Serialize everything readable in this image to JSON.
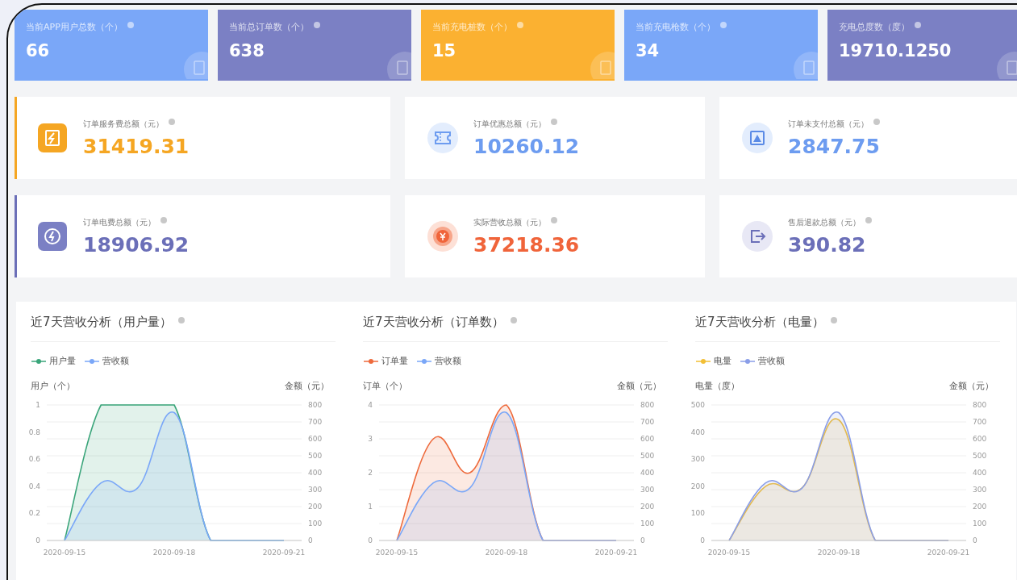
{
  "stat_cards": [
    {
      "label": "当前APP用户总数（个）",
      "value": "66",
      "color": "#7aa7f8"
    },
    {
      "label": "当前总订单数（个）",
      "value": "638",
      "color": "#7b80c4"
    },
    {
      "label": "当前充电桩数（个）",
      "value": "15",
      "color": "#fbb131"
    },
    {
      "label": "当前充电枪数（个）",
      "value": "34",
      "color": "#7aa7f8"
    },
    {
      "label": "充电总度数（度）",
      "value": "19710.1250",
      "color": "#7b80c4"
    }
  ],
  "amount_cards": [
    {
      "label": "订单服务费总额（元）",
      "value": "31419.31",
      "color": "#f5a623",
      "accent_bar": true
    },
    {
      "label": "订单优惠总额（元）",
      "value": "10260.12",
      "color": "#6d9cf0",
      "accent_bar": false
    },
    {
      "label": "订单未支付总额（元）",
      "value": "2847.75",
      "color": "#6d9cf0",
      "accent_bar": false
    },
    {
      "label": "订单电费总额（元）",
      "value": "18906.92",
      "color": "#6b6fb8",
      "accent_bar": true
    },
    {
      "label": "实际营收总额（元）",
      "value": "37218.36",
      "color": "#f0643a",
      "accent_bar": false
    },
    {
      "label": "售后退款总额（元）",
      "value": "390.82",
      "color": "#6b6fb8",
      "accent_bar": false
    }
  ],
  "charts": [
    {
      "title": "近7天营收分析（用户量）",
      "chart_data": {
        "type": "area",
        "ylabel": "用户（个）",
        "y2label": "金额（元）",
        "categories": [
          "2020-09-15",
          null,
          null,
          "2020-09-18",
          null,
          null,
          "2020-09-21"
        ],
        "grid": true,
        "ylim": [
          0,
          1
        ],
        "yticks": [
          0,
          0.2,
          0.4,
          0.6,
          0.8,
          1
        ],
        "y2lim": [
          0,
          800
        ],
        "y2ticks": [
          0,
          100,
          200,
          300,
          400,
          500,
          600,
          700,
          800
        ],
        "series": [
          {
            "name": "用户量",
            "color": "#3aa57a",
            "values": [
              0,
              1,
              1,
              1,
              0,
              0,
              0
            ]
          },
          {
            "name": "营收额",
            "color": "#7aa7f8",
            "axis": "y2",
            "values": [
              0,
              340,
              310,
              755,
              0,
              0,
              0
            ]
          }
        ]
      }
    },
    {
      "title": "近7天营收分析（订单数）",
      "chart_data": {
        "type": "area",
        "ylabel": "订单（个）",
        "y2label": "金额（元）",
        "categories": [
          "2020-09-15",
          null,
          null,
          "2020-09-18",
          null,
          null,
          "2020-09-21"
        ],
        "grid": true,
        "ylim": [
          0,
          4
        ],
        "yticks": [
          0,
          1,
          2,
          3,
          4
        ],
        "y2lim": [
          0,
          800
        ],
        "y2ticks": [
          0,
          100,
          200,
          300,
          400,
          500,
          600,
          700,
          800
        ],
        "series": [
          {
            "name": "订单量",
            "color": "#ee6a3c",
            "values": [
              0,
              3,
              2,
              4,
              0,
              0,
              0
            ]
          },
          {
            "name": "营收额",
            "color": "#7aa7f8",
            "axis": "y2",
            "values": [
              0,
              340,
              310,
              755,
              0,
              0,
              0
            ]
          }
        ]
      }
    },
    {
      "title": "近7天营收分析（电量）",
      "chart_data": {
        "type": "area",
        "ylabel": "电量（度）",
        "y2label": "金额（元）",
        "categories": [
          "2020-09-15",
          null,
          null,
          "2020-09-18",
          null,
          null,
          "2020-09-21"
        ],
        "grid": true,
        "ylim": [
          0,
          500
        ],
        "yticks": [
          0,
          100,
          200,
          300,
          400,
          500
        ],
        "y2lim": [
          0,
          800
        ],
        "y2ticks": [
          0,
          100,
          200,
          300,
          400,
          500,
          600,
          700,
          800
        ],
        "series": [
          {
            "name": "电量",
            "color": "#f2bf35",
            "values": [
              0,
              200,
              195,
              445,
              0,
              0,
              0
            ]
          },
          {
            "name": "营收额",
            "color": "#8a9ee8",
            "axis": "y2",
            "values": [
              0,
              340,
              310,
              755,
              0,
              0,
              0
            ]
          }
        ]
      }
    }
  ]
}
